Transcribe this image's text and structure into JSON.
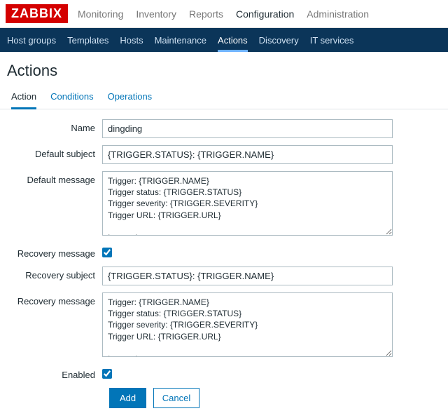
{
  "logo": "ZABBIX",
  "topnav": {
    "monitoring": "Monitoring",
    "inventory": "Inventory",
    "reports": "Reports",
    "configuration": "Configuration",
    "administration": "Administration"
  },
  "subnav": {
    "host_groups": "Host groups",
    "templates": "Templates",
    "hosts": "Hosts",
    "maintenance": "Maintenance",
    "actions": "Actions",
    "discovery": "Discovery",
    "it_services": "IT services"
  },
  "page_title": "Actions",
  "tabs": {
    "action": "Action",
    "conditions": "Conditions",
    "operations": "Operations"
  },
  "form": {
    "name_label": "Name",
    "name_value": "dingding",
    "default_subject_label": "Default subject",
    "default_subject_value": "{TRIGGER.STATUS}: {TRIGGER.NAME}",
    "default_message_label": "Default message",
    "default_message_value": "Trigger: {TRIGGER.NAME}\nTrigger status: {TRIGGER.STATUS}\nTrigger severity: {TRIGGER.SEVERITY}\nTrigger URL: {TRIGGER.URL}\n\nItem values:\n",
    "recovery_message_label": "Recovery message",
    "recovery_message_checked": true,
    "recovery_subject_label": "Recovery subject",
    "recovery_subject_value": "{TRIGGER.STATUS}: {TRIGGER.NAME}",
    "recovery_message_body_label": "Recovery message",
    "recovery_message_body_value": "Trigger: {TRIGGER.NAME}\nTrigger status: {TRIGGER.STATUS}\nTrigger severity: {TRIGGER.SEVERITY}\nTrigger URL: {TRIGGER.URL}\n\nItem values:\n",
    "enabled_label": "Enabled",
    "enabled_checked": true,
    "add_btn": "Add",
    "cancel_btn": "Cancel"
  }
}
